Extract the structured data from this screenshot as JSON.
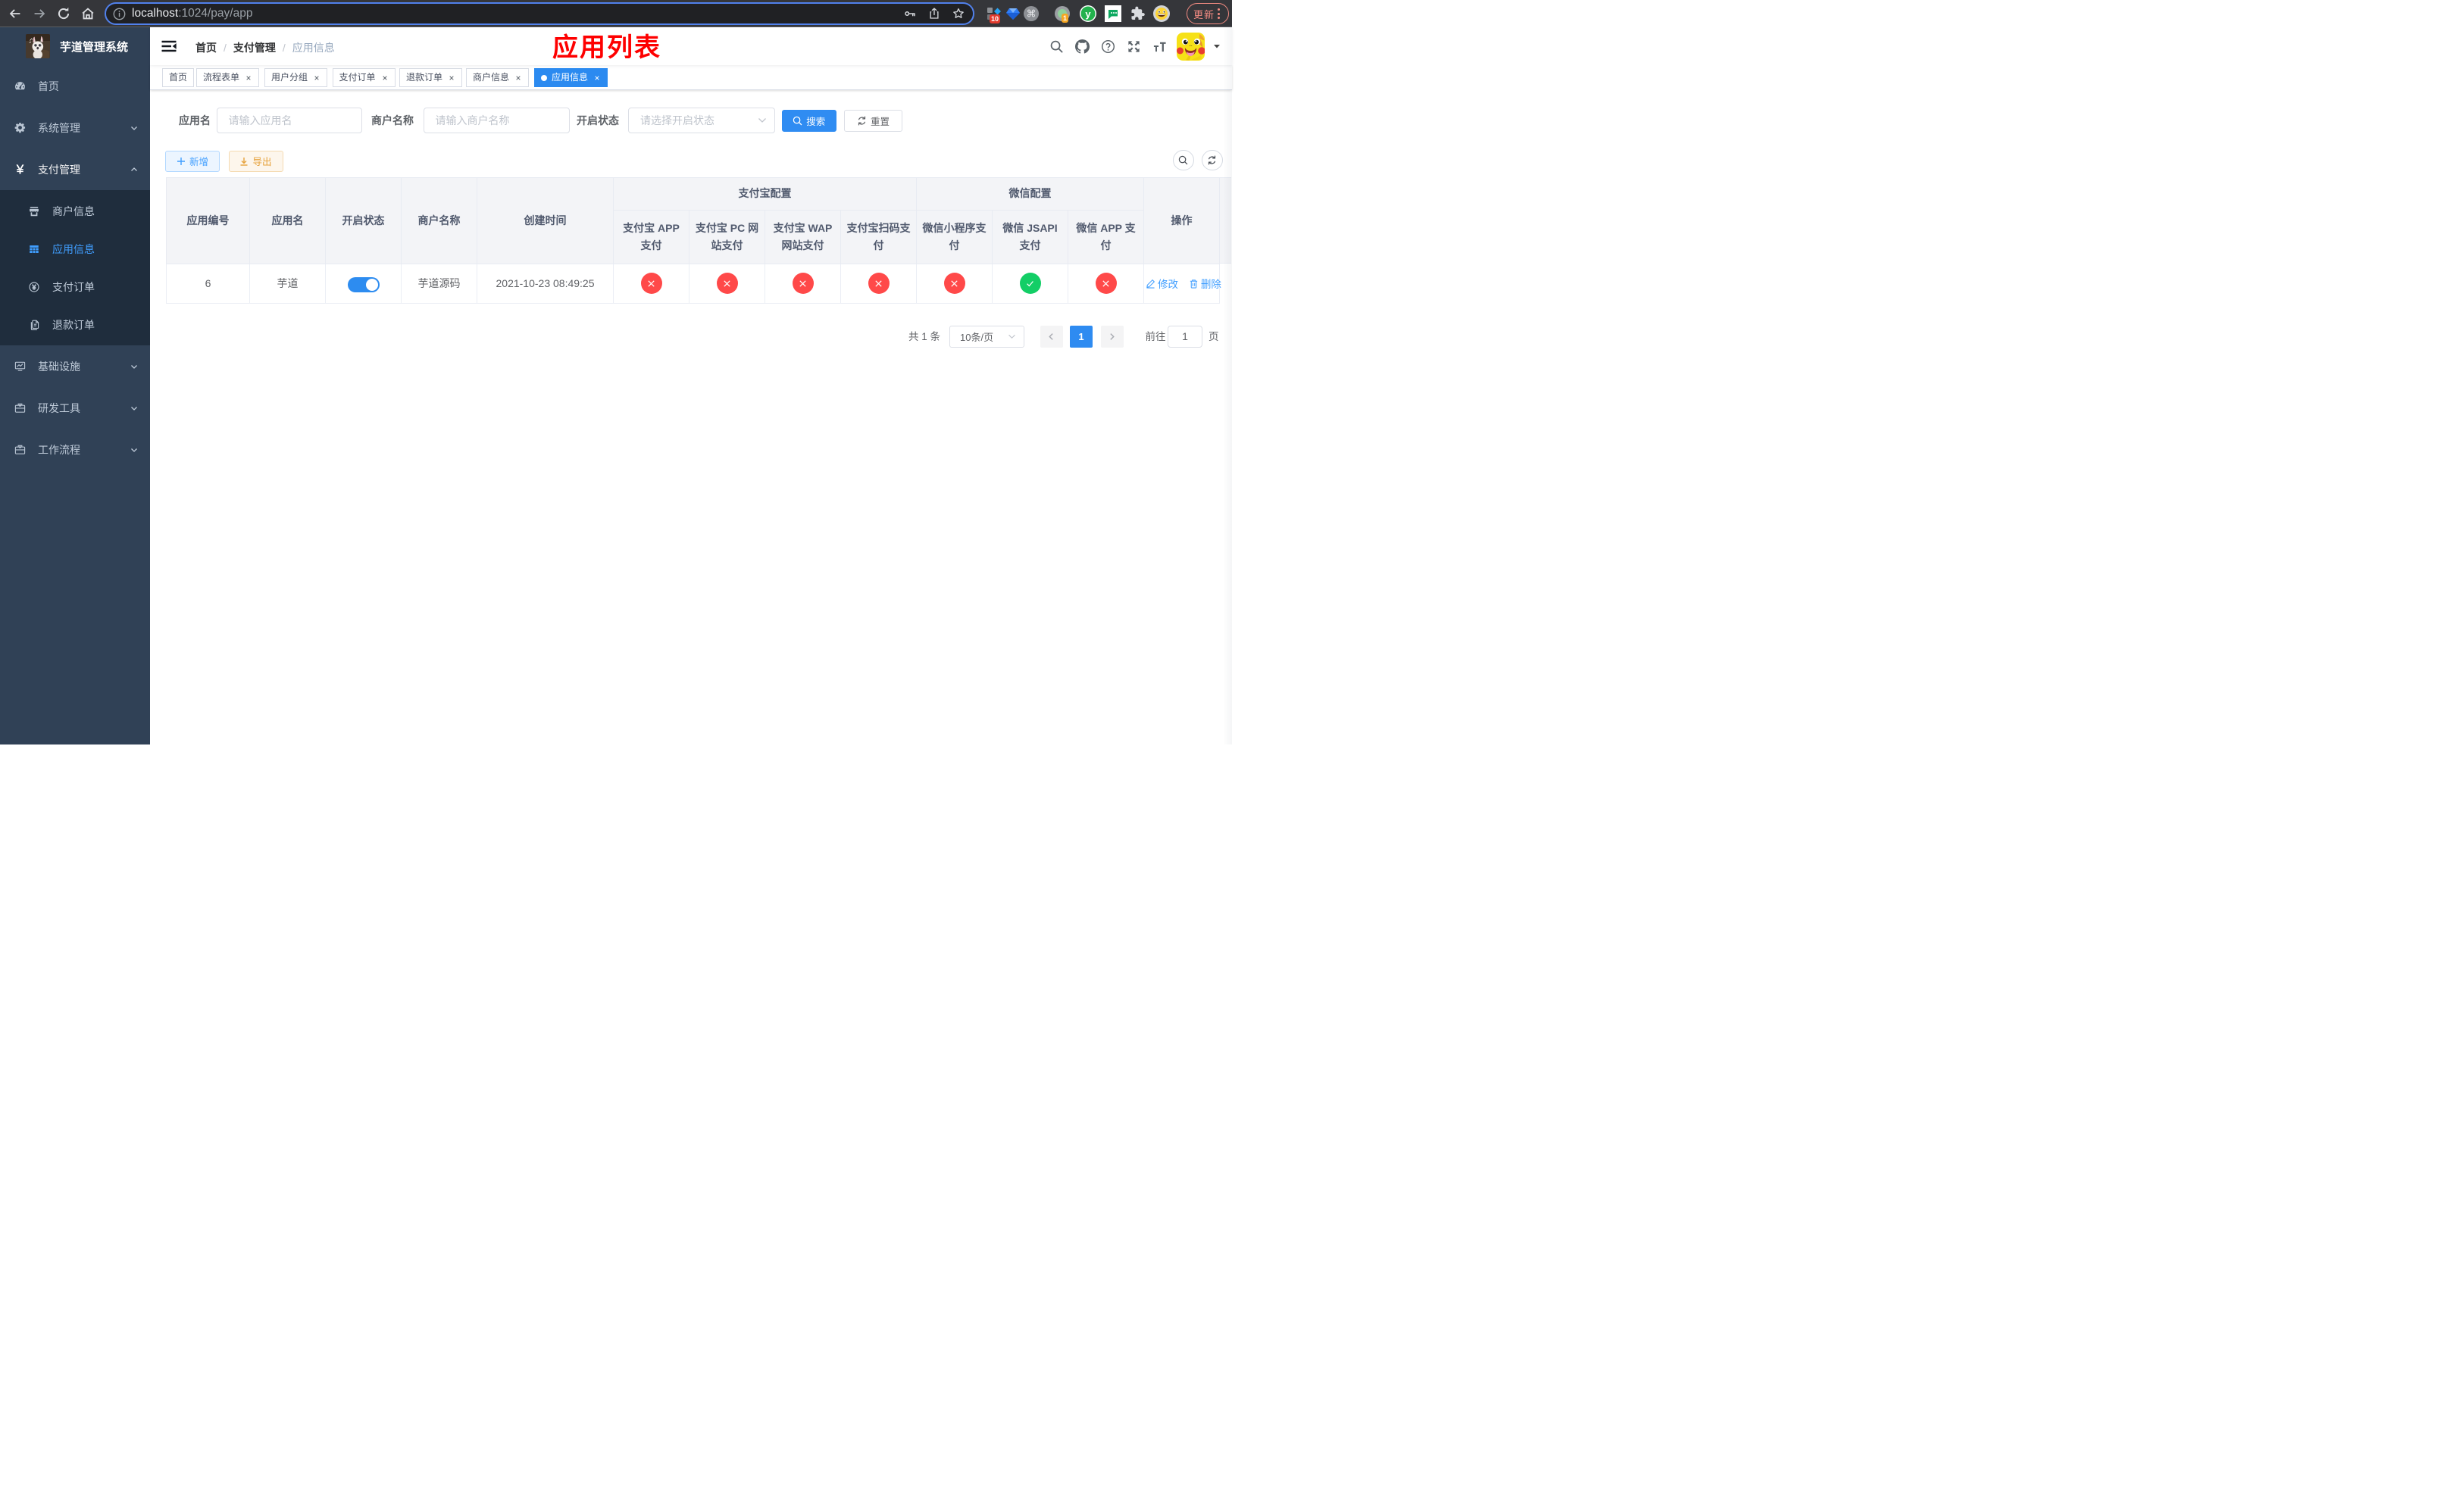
{
  "browser": {
    "url_host": "localhost",
    "url_rest": ":1024/pay/app",
    "update_label": "更新",
    "ext_badge_blue": "10",
    "ext_badge_rec": "1"
  },
  "sidebar": {
    "title": "芋道管理系统",
    "items": [
      {
        "label": "首页",
        "icon": "dashboard-icon",
        "expandable": false
      },
      {
        "label": "系统管理",
        "icon": "gear-icon",
        "expandable": true
      },
      {
        "label": "支付管理",
        "icon": "yen-icon",
        "expandable": true,
        "expanded": true
      },
      {
        "label": "基础设施",
        "icon": "monitor-icon",
        "expandable": true
      },
      {
        "label": "研发工具",
        "icon": "toolbox-icon",
        "expandable": true
      },
      {
        "label": "工作流程",
        "icon": "workflow-icon",
        "expandable": true
      }
    ],
    "submenu_pay": [
      {
        "label": "商户信息",
        "icon": "shop-icon",
        "active": false
      },
      {
        "label": "应用信息",
        "icon": "grid-icon",
        "active": true
      },
      {
        "label": "支付订单",
        "icon": "yen-circle-icon",
        "active": false
      },
      {
        "label": "退款订单",
        "icon": "documents-icon",
        "active": false
      }
    ]
  },
  "header": {
    "breadcrumb": {
      "b0": "首页",
      "b1": "支付管理",
      "b2": "应用信息"
    },
    "annotation": "应用列表"
  },
  "tags": [
    {
      "label": "首页"
    },
    {
      "label": "流程表单"
    },
    {
      "label": "用户分组"
    },
    {
      "label": "支付订单"
    },
    {
      "label": "退款订单"
    },
    {
      "label": "商户信息"
    },
    {
      "label": "应用信息"
    }
  ],
  "filter": {
    "app_name_label": "应用名",
    "app_name_placeholder": "请输入应用名",
    "merchant_label": "商户名称",
    "merchant_placeholder": "请输入商户名称",
    "status_label": "开启状态",
    "status_placeholder": "请选择开启状态",
    "search_label": "搜索",
    "reset_label": "重置"
  },
  "toolbar": {
    "add_label": "新增",
    "export_label": "导出"
  },
  "table": {
    "headers": {
      "app_id": "应用编号",
      "app_name": "应用名",
      "status": "开启状态",
      "merchant": "商户名称",
      "create_time": "创建时间",
      "alipay_group": "支付宝配置",
      "wechat_group": "微信配置",
      "alipay_app_l1": "支付宝 APP",
      "alipay_app_l2": "支付",
      "alipay_pc_l1": "支付宝 PC 网",
      "alipay_pc_l2": "站支付",
      "alipay_wap_l1": "支付宝 WAP",
      "alipay_wap_l2": "网站支付",
      "alipay_qr_l1": "支付宝扫码支",
      "alipay_qr_l2": "付",
      "wx_lite_l1": "微信小程序支",
      "wx_lite_l2": "付",
      "wx_jsapi_l1": "微信 JSAPI",
      "wx_jsapi_l2": "支付",
      "wx_app_l1": "微信 APP 支",
      "wx_app_l2": "付",
      "op": "操作"
    },
    "row": {
      "app_id": "6",
      "app_name": "芋道",
      "status_on": true,
      "merchant": "芋道源码",
      "create_time": "2021-10-23 08:49:25",
      "statuses": [
        "no",
        "no",
        "no",
        "no",
        "no",
        "yes",
        "no"
      ],
      "edit_label": "修改",
      "delete_label": "删除"
    }
  },
  "pagination": {
    "total_label": "共 1 条",
    "size_label": "10条/页",
    "current_page": "1",
    "goto_label": "前往",
    "goto_value": "1",
    "page_label": "页"
  },
  "colors": {
    "primary": "#409eff",
    "danger": "#ff4949",
    "success": "#13ce66",
    "sidebar_bg": "#304156",
    "submenu_bg": "#1f2d3d"
  }
}
